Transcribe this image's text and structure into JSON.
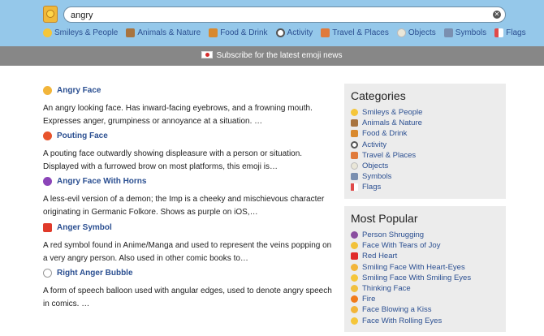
{
  "search": {
    "value": "angry"
  },
  "nav": [
    {
      "label": "Smileys & People",
      "icon": "smiley-icon",
      "color": "#f5c63a"
    },
    {
      "label": "Animals & Nature",
      "icon": "bear-icon",
      "color": "#a8743f"
    },
    {
      "label": "Food & Drink",
      "icon": "burger-icon",
      "color": "#d9892e"
    },
    {
      "label": "Activity",
      "icon": "soccer-ball-icon",
      "color": "#555555"
    },
    {
      "label": "Travel & Places",
      "icon": "city-icon",
      "color": "#e07a3b"
    },
    {
      "label": "Objects",
      "icon": "lightbulb-icon",
      "color": "#e9e6d8"
    },
    {
      "label": "Symbols",
      "icon": "symbols-icon",
      "color": "#7a8fb0"
    },
    {
      "label": "Flags",
      "icon": "flags-icon",
      "color": "#e04a4a"
    }
  ],
  "banner": {
    "text": "Subscribe for the latest emoji news"
  },
  "results": [
    {
      "title": "Angry Face",
      "icon": "angry-face-icon",
      "color": "#f2b53a",
      "desc": "An angry looking face. Has inward-facing eyebrows, and a frowning mouth. Expresses anger, grumpiness or annoyance at a situation. …"
    },
    {
      "title": "Pouting Face",
      "icon": "pouting-face-icon",
      "color": "#e8542c",
      "desc": "A pouting face outwardly showing displeasure with a person or situation. Displayed with a furrowed brow on most platforms, this emoji is…"
    },
    {
      "title": "Angry Face With Horns",
      "icon": "imp-icon",
      "color": "#8b45b8",
      "desc": "A less-evil version of a demon; the Imp is a cheeky and mischievous character originating in Germanic Folkore. Shows as purple on iOS,…"
    },
    {
      "title": "Anger Symbol",
      "icon": "anger-symbol-icon",
      "color": "#e03a2a",
      "desc": "A red symbol found in Anime/Manga and used to represent the veins popping on a very angry person. Also used in other comic books to…"
    },
    {
      "title": "Right Anger Bubble",
      "icon": "anger-bubble-icon",
      "color": "#dddddd",
      "desc": "A form of speech balloon used with angular edges, used to denote angry speech in comics. …"
    }
  ],
  "categories": {
    "heading": "Categories",
    "items": [
      {
        "label": "Smileys & People",
        "icon": "smiley-icon",
        "color": "#f5c63a"
      },
      {
        "label": "Animals & Nature",
        "icon": "bear-icon",
        "color": "#a8743f"
      },
      {
        "label": "Food & Drink",
        "icon": "burger-icon",
        "color": "#d9892e"
      },
      {
        "label": "Activity",
        "icon": "soccer-ball-icon",
        "color": "#555555"
      },
      {
        "label": "Travel & Places",
        "icon": "city-icon",
        "color": "#e07a3b"
      },
      {
        "label": "Objects",
        "icon": "lightbulb-icon",
        "color": "#e9e6d8"
      },
      {
        "label": "Symbols",
        "icon": "symbols-icon",
        "color": "#7a8fb0"
      },
      {
        "label": "Flags",
        "icon": "flags-icon",
        "color": "#e04a4a"
      }
    ]
  },
  "popular": {
    "heading": "Most Popular",
    "items": [
      {
        "label": "Person Shrugging",
        "icon": "person-shrugging-icon",
        "color": "#8a4ea0"
      },
      {
        "label": "Face With Tears of Joy",
        "icon": "tears-of-joy-icon",
        "color": "#f2c23a"
      },
      {
        "label": "Red Heart",
        "icon": "red-heart-icon",
        "color": "#e02a2a"
      },
      {
        "label": "Smiling Face With Heart-Eyes",
        "icon": "heart-eyes-icon",
        "color": "#f2b53a"
      },
      {
        "label": "Smiling Face With Smiling Eyes",
        "icon": "smiling-eyes-icon",
        "color": "#f5c63a"
      },
      {
        "label": "Thinking Face",
        "icon": "thinking-face-icon",
        "color": "#f0c040"
      },
      {
        "label": "Fire",
        "icon": "fire-icon",
        "color": "#f07a1a"
      },
      {
        "label": "Face Blowing a Kiss",
        "icon": "blowing-kiss-icon",
        "color": "#f2b53a"
      },
      {
        "label": "Face With Rolling Eyes",
        "icon": "rolling-eyes-icon",
        "color": "#f5c63a"
      }
    ]
  }
}
